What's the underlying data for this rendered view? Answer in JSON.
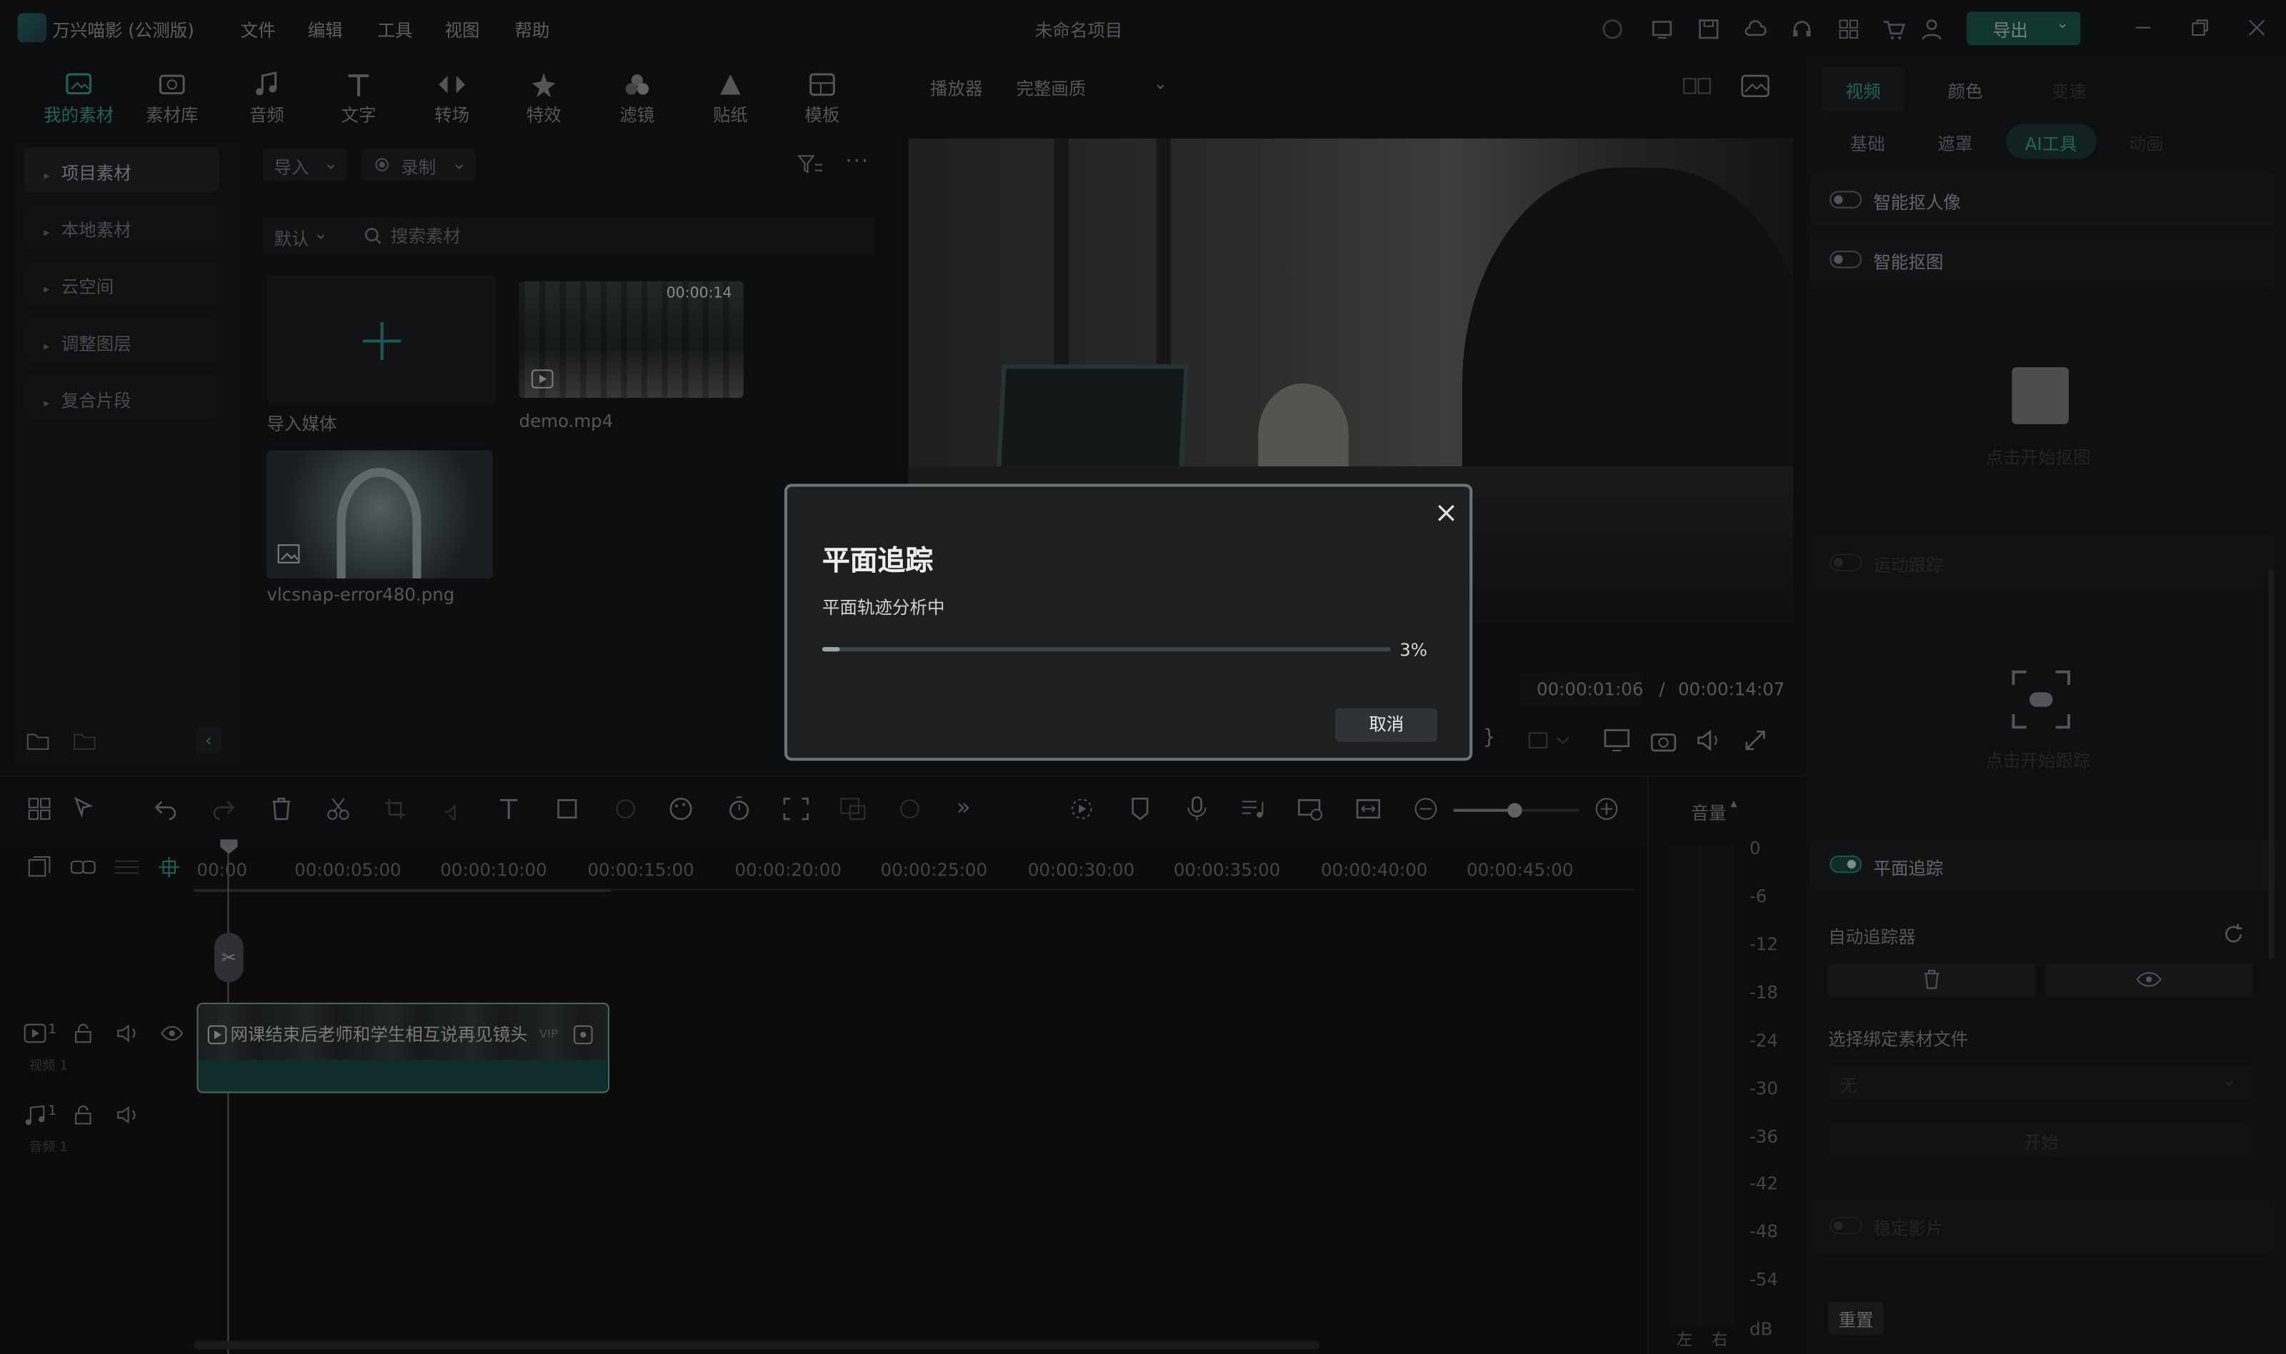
{
  "app": {
    "name": "万兴喵影 (公测版)",
    "menu": [
      "文件",
      "编辑",
      "工具",
      "视图",
      "帮助"
    ],
    "project_title": "未命名项目",
    "export_label": "导出"
  },
  "toolbar": {
    "items": [
      {
        "label": "我的素材",
        "icon": "media-icon",
        "active": true
      },
      {
        "label": "素材库",
        "icon": "library-icon"
      },
      {
        "label": "音频",
        "icon": "music-icon"
      },
      {
        "label": "文字",
        "icon": "text-icon"
      },
      {
        "label": "转场",
        "icon": "transition-icon"
      },
      {
        "label": "特效",
        "icon": "effects-icon"
      },
      {
        "label": "滤镜",
        "icon": "filter-icon"
      },
      {
        "label": "贴纸",
        "icon": "sticker-icon"
      },
      {
        "label": "模板",
        "icon": "template-icon"
      }
    ],
    "player_label": "播放器",
    "quality_label": "完整画质"
  },
  "left_panel": {
    "items": [
      "项目素材",
      "本地素材",
      "云空间",
      "调整图层",
      "复合片段"
    ]
  },
  "media_panel": {
    "import_label": "导入",
    "record_label": "录制",
    "sort_label": "默认",
    "search_placeholder": "搜索素材",
    "items": [
      {
        "name": "导入媒体"
      },
      {
        "name": "demo.mp4",
        "duration": "00:00:14"
      },
      {
        "name": "vlcsnap-error480.png"
      }
    ]
  },
  "preview": {
    "current_time": "00:00:01:06",
    "separator": "/",
    "total_time": "00:00:14:07"
  },
  "right_panel": {
    "tabs": [
      "视频",
      "颜色",
      "变速"
    ],
    "subtabs": [
      "基础",
      "遮罩",
      "AI工具",
      "动画"
    ],
    "active_subtab": "AI工具",
    "smart_cutout_person": "智能抠人像",
    "smart_cutout": "智能抠图",
    "click_start_cutout": "点击开始抠图",
    "motion_tracking": "运动跟踪",
    "click_start_tracking": "点击开始跟踪",
    "planar_tracking": "平面追踪",
    "auto_tracker": "自动追踪器",
    "bind_label": "选择绑定素材文件",
    "bind_value": "无",
    "start_label": "开始",
    "stabilize": "稳定影片",
    "reset_label": "重置"
  },
  "timeline": {
    "ticks": [
      "00:00",
      "00:00:05:00",
      "00:00:10:00",
      "00:00:15:00",
      "00:00:20:00",
      "00:00:25:00",
      "00:00:30:00",
      "00:00:35:00",
      "00:00:40:00",
      "00:00:45:00"
    ],
    "video_track": "视频 1",
    "audio_track": "音频 1",
    "track_num": "1",
    "clip_label": "网课结束后老师和学生相互说再见镜头",
    "clip_badge": "VIP"
  },
  "meter": {
    "label": "音量",
    "db_values": [
      "0",
      "-6",
      "-12",
      "-18",
      "-24",
      "-30",
      "-36",
      "-42",
      "-48",
      "-54",
      "dB"
    ],
    "left": "左",
    "right": "右"
  },
  "dialog": {
    "title": "平面追踪",
    "subtitle": "平面轨迹分析中",
    "progress": 0.03,
    "progress_label": "3%",
    "cancel_label": "取消"
  },
  "colors": {
    "accent": "#1b5b4c",
    "active_text": "#3aa597",
    "clip": "#1a4947"
  }
}
